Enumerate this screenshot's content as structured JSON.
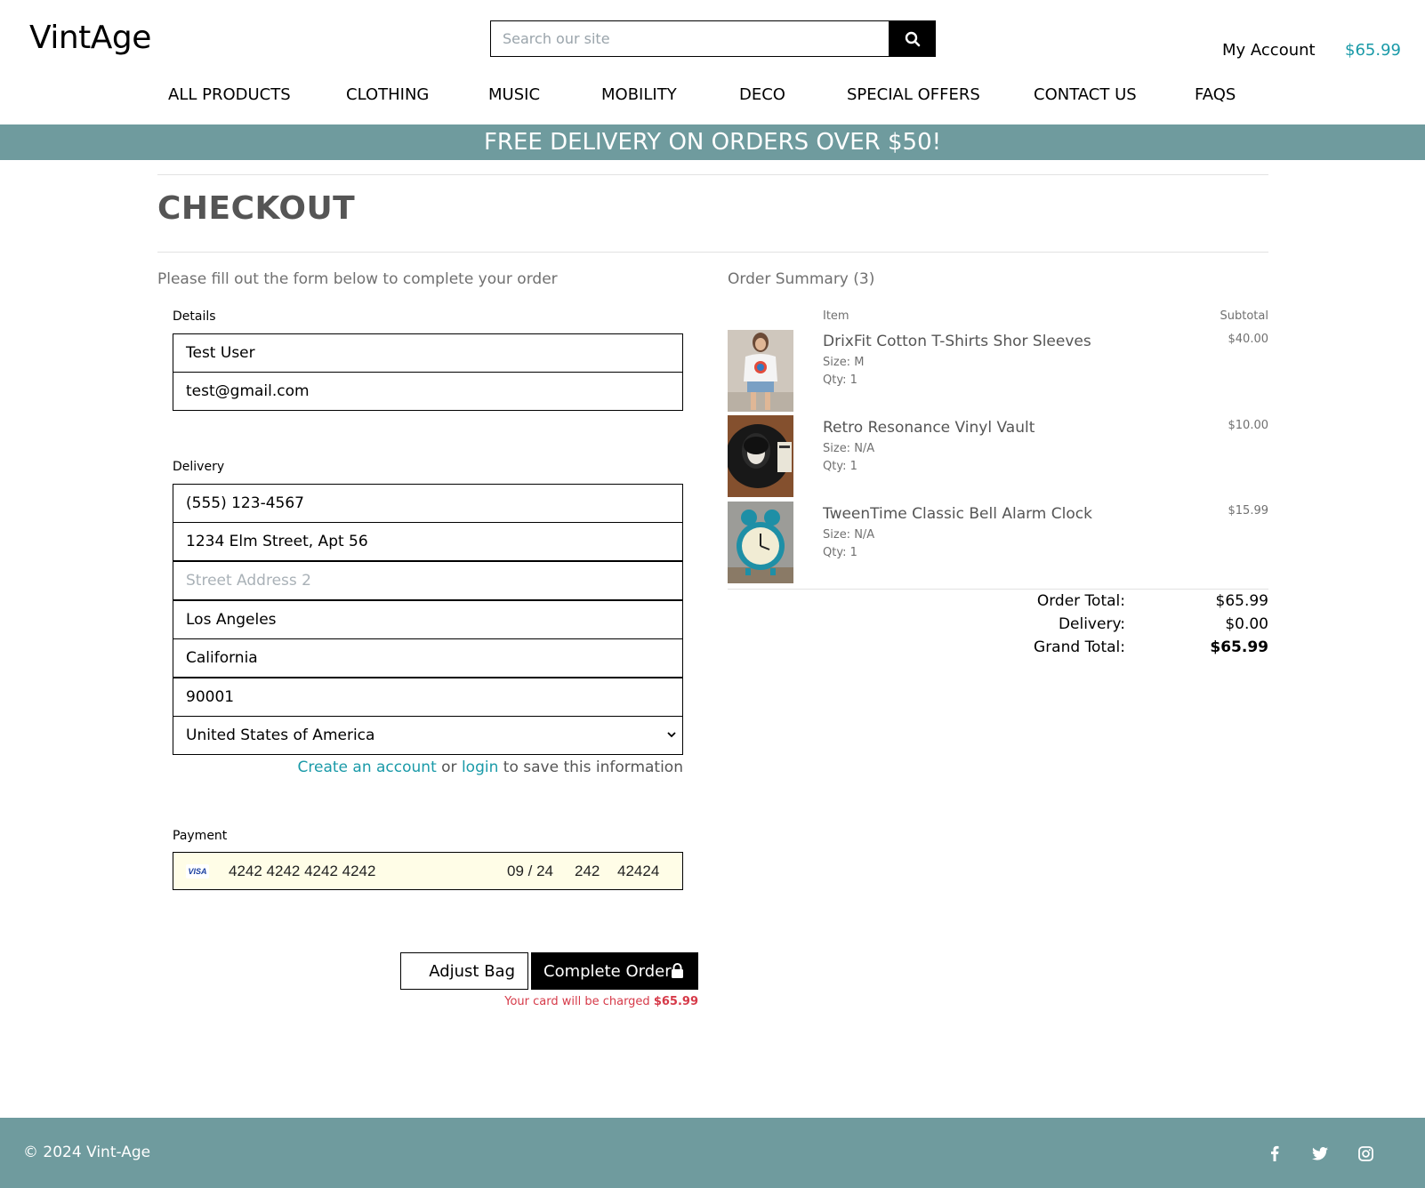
{
  "header": {
    "logo": "VintAge",
    "search_placeholder": "Search our site",
    "account_label": "My Account",
    "cart_total": "$65.99",
    "accent_color": "#1a9aa8"
  },
  "nav": {
    "items": [
      "ALL PRODUCTS",
      "CLOTHING",
      "MUSIC",
      "MOBILITY",
      "DECO",
      "SPECIAL OFFERS",
      "CONTACT US",
      "FAQS"
    ]
  },
  "banner": {
    "text": "FREE DELIVERY ON ORDERS OVER $50!",
    "color": "#6f9b9e"
  },
  "checkout": {
    "title": "CHECKOUT",
    "intro": "Please fill out the form below to complete your order",
    "details_label": "Details",
    "name_value": "Test User",
    "email_value": "test@gmail.com",
    "delivery_label": "Delivery",
    "phone_value": "(555) 123-4567",
    "address1_value": "1234 Elm Street, Apt 56",
    "address2_placeholder": "Street Address 2",
    "city_value": "Los Angeles",
    "state_value": "California",
    "zip_value": "90001",
    "country_selected": "United States of America",
    "save_info": {
      "create_link": "Create an account",
      "or_text": " or ",
      "login_link": "login",
      "suffix": " to save this information"
    },
    "payment_label": "Payment",
    "card": {
      "brand": "VISA",
      "number": "4242 4242 4242 4242",
      "expiry": "09 / 24",
      "cvc": "242",
      "postal": "42424"
    },
    "adjust_button": "Adjust Bag",
    "complete_button": "Complete Order",
    "charge_note_prefix": "Your card will be charged ",
    "charge_amount": "$65.99",
    "charge_color": "#d63a49"
  },
  "summary": {
    "title": "Order Summary (3)",
    "col_item": "Item",
    "col_subtotal": "Subtotal",
    "items": [
      {
        "name": "DrixFit Cotton T-Shirts Shor Sleeves",
        "size": "Size: M",
        "qty": "Qty: 1",
        "price": "$40.00",
        "icon": "tshirt-photo"
      },
      {
        "name": "Retro Resonance Vinyl Vault",
        "size": "Size: N/A",
        "qty": "Qty: 1",
        "price": "$10.00",
        "icon": "vinyl-record-photo"
      },
      {
        "name": "TweenTime Classic Bell Alarm Clock",
        "size": "Size: N/A",
        "qty": "Qty: 1",
        "price": "$15.99",
        "icon": "alarm-clock-photo"
      }
    ],
    "order_total_label": "Order Total:",
    "order_total": "$65.99",
    "delivery_label": "Delivery:",
    "delivery": "$0.00",
    "grand_total_label": "Grand Total:",
    "grand_total": "$65.99"
  },
  "footer": {
    "copyright": "© 2024 Vint-Age",
    "social_icons": [
      "facebook-icon",
      "twitter-icon",
      "instagram-icon"
    ],
    "color": "#6f9b9e"
  }
}
